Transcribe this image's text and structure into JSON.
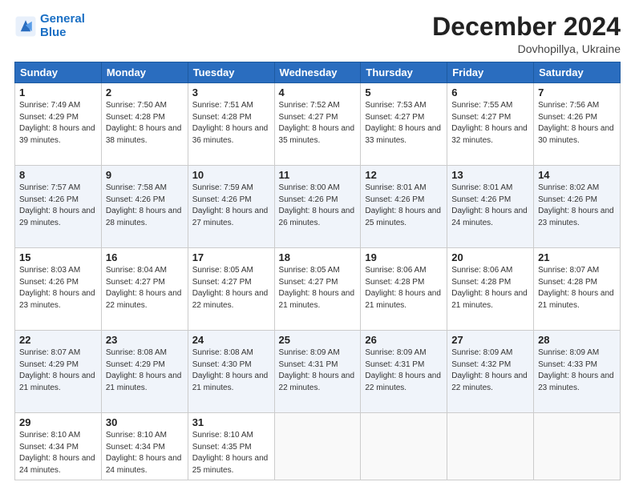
{
  "logo": {
    "line1": "General",
    "line2": "Blue"
  },
  "title": "December 2024",
  "location": "Dovhopillya, Ukraine",
  "weekdays": [
    "Sunday",
    "Monday",
    "Tuesday",
    "Wednesday",
    "Thursday",
    "Friday",
    "Saturday"
  ],
  "weeks": [
    [
      {
        "day": "1",
        "sunrise": "7:49 AM",
        "sunset": "4:29 PM",
        "daylight": "8 hours and 39 minutes."
      },
      {
        "day": "2",
        "sunrise": "7:50 AM",
        "sunset": "4:28 PM",
        "daylight": "8 hours and 38 minutes."
      },
      {
        "day": "3",
        "sunrise": "7:51 AM",
        "sunset": "4:28 PM",
        "daylight": "8 hours and 36 minutes."
      },
      {
        "day": "4",
        "sunrise": "7:52 AM",
        "sunset": "4:27 PM",
        "daylight": "8 hours and 35 minutes."
      },
      {
        "day": "5",
        "sunrise": "7:53 AM",
        "sunset": "4:27 PM",
        "daylight": "8 hours and 33 minutes."
      },
      {
        "day": "6",
        "sunrise": "7:55 AM",
        "sunset": "4:27 PM",
        "daylight": "8 hours and 32 minutes."
      },
      {
        "day": "7",
        "sunrise": "7:56 AM",
        "sunset": "4:26 PM",
        "daylight": "8 hours and 30 minutes."
      }
    ],
    [
      {
        "day": "8",
        "sunrise": "7:57 AM",
        "sunset": "4:26 PM",
        "daylight": "8 hours and 29 minutes."
      },
      {
        "day": "9",
        "sunrise": "7:58 AM",
        "sunset": "4:26 PM",
        "daylight": "8 hours and 28 minutes."
      },
      {
        "day": "10",
        "sunrise": "7:59 AM",
        "sunset": "4:26 PM",
        "daylight": "8 hours and 27 minutes."
      },
      {
        "day": "11",
        "sunrise": "8:00 AM",
        "sunset": "4:26 PM",
        "daylight": "8 hours and 26 minutes."
      },
      {
        "day": "12",
        "sunrise": "8:01 AM",
        "sunset": "4:26 PM",
        "daylight": "8 hours and 25 minutes."
      },
      {
        "day": "13",
        "sunrise": "8:01 AM",
        "sunset": "4:26 PM",
        "daylight": "8 hours and 24 minutes."
      },
      {
        "day": "14",
        "sunrise": "8:02 AM",
        "sunset": "4:26 PM",
        "daylight": "8 hours and 23 minutes."
      }
    ],
    [
      {
        "day": "15",
        "sunrise": "8:03 AM",
        "sunset": "4:26 PM",
        "daylight": "8 hours and 23 minutes."
      },
      {
        "day": "16",
        "sunrise": "8:04 AM",
        "sunset": "4:27 PM",
        "daylight": "8 hours and 22 minutes."
      },
      {
        "day": "17",
        "sunrise": "8:05 AM",
        "sunset": "4:27 PM",
        "daylight": "8 hours and 22 minutes."
      },
      {
        "day": "18",
        "sunrise": "8:05 AM",
        "sunset": "4:27 PM",
        "daylight": "8 hours and 21 minutes."
      },
      {
        "day": "19",
        "sunrise": "8:06 AM",
        "sunset": "4:28 PM",
        "daylight": "8 hours and 21 minutes."
      },
      {
        "day": "20",
        "sunrise": "8:06 AM",
        "sunset": "4:28 PM",
        "daylight": "8 hours and 21 minutes."
      },
      {
        "day": "21",
        "sunrise": "8:07 AM",
        "sunset": "4:28 PM",
        "daylight": "8 hours and 21 minutes."
      }
    ],
    [
      {
        "day": "22",
        "sunrise": "8:07 AM",
        "sunset": "4:29 PM",
        "daylight": "8 hours and 21 minutes."
      },
      {
        "day": "23",
        "sunrise": "8:08 AM",
        "sunset": "4:29 PM",
        "daylight": "8 hours and 21 minutes."
      },
      {
        "day": "24",
        "sunrise": "8:08 AM",
        "sunset": "4:30 PM",
        "daylight": "8 hours and 21 minutes."
      },
      {
        "day": "25",
        "sunrise": "8:09 AM",
        "sunset": "4:31 PM",
        "daylight": "8 hours and 22 minutes."
      },
      {
        "day": "26",
        "sunrise": "8:09 AM",
        "sunset": "4:31 PM",
        "daylight": "8 hours and 22 minutes."
      },
      {
        "day": "27",
        "sunrise": "8:09 AM",
        "sunset": "4:32 PM",
        "daylight": "8 hours and 22 minutes."
      },
      {
        "day": "28",
        "sunrise": "8:09 AM",
        "sunset": "4:33 PM",
        "daylight": "8 hours and 23 minutes."
      }
    ],
    [
      {
        "day": "29",
        "sunrise": "8:10 AM",
        "sunset": "4:34 PM",
        "daylight": "8 hours and 24 minutes."
      },
      {
        "day": "30",
        "sunrise": "8:10 AM",
        "sunset": "4:34 PM",
        "daylight": "8 hours and 24 minutes."
      },
      {
        "day": "31",
        "sunrise": "8:10 AM",
        "sunset": "4:35 PM",
        "daylight": "8 hours and 25 minutes."
      },
      null,
      null,
      null,
      null
    ]
  ]
}
